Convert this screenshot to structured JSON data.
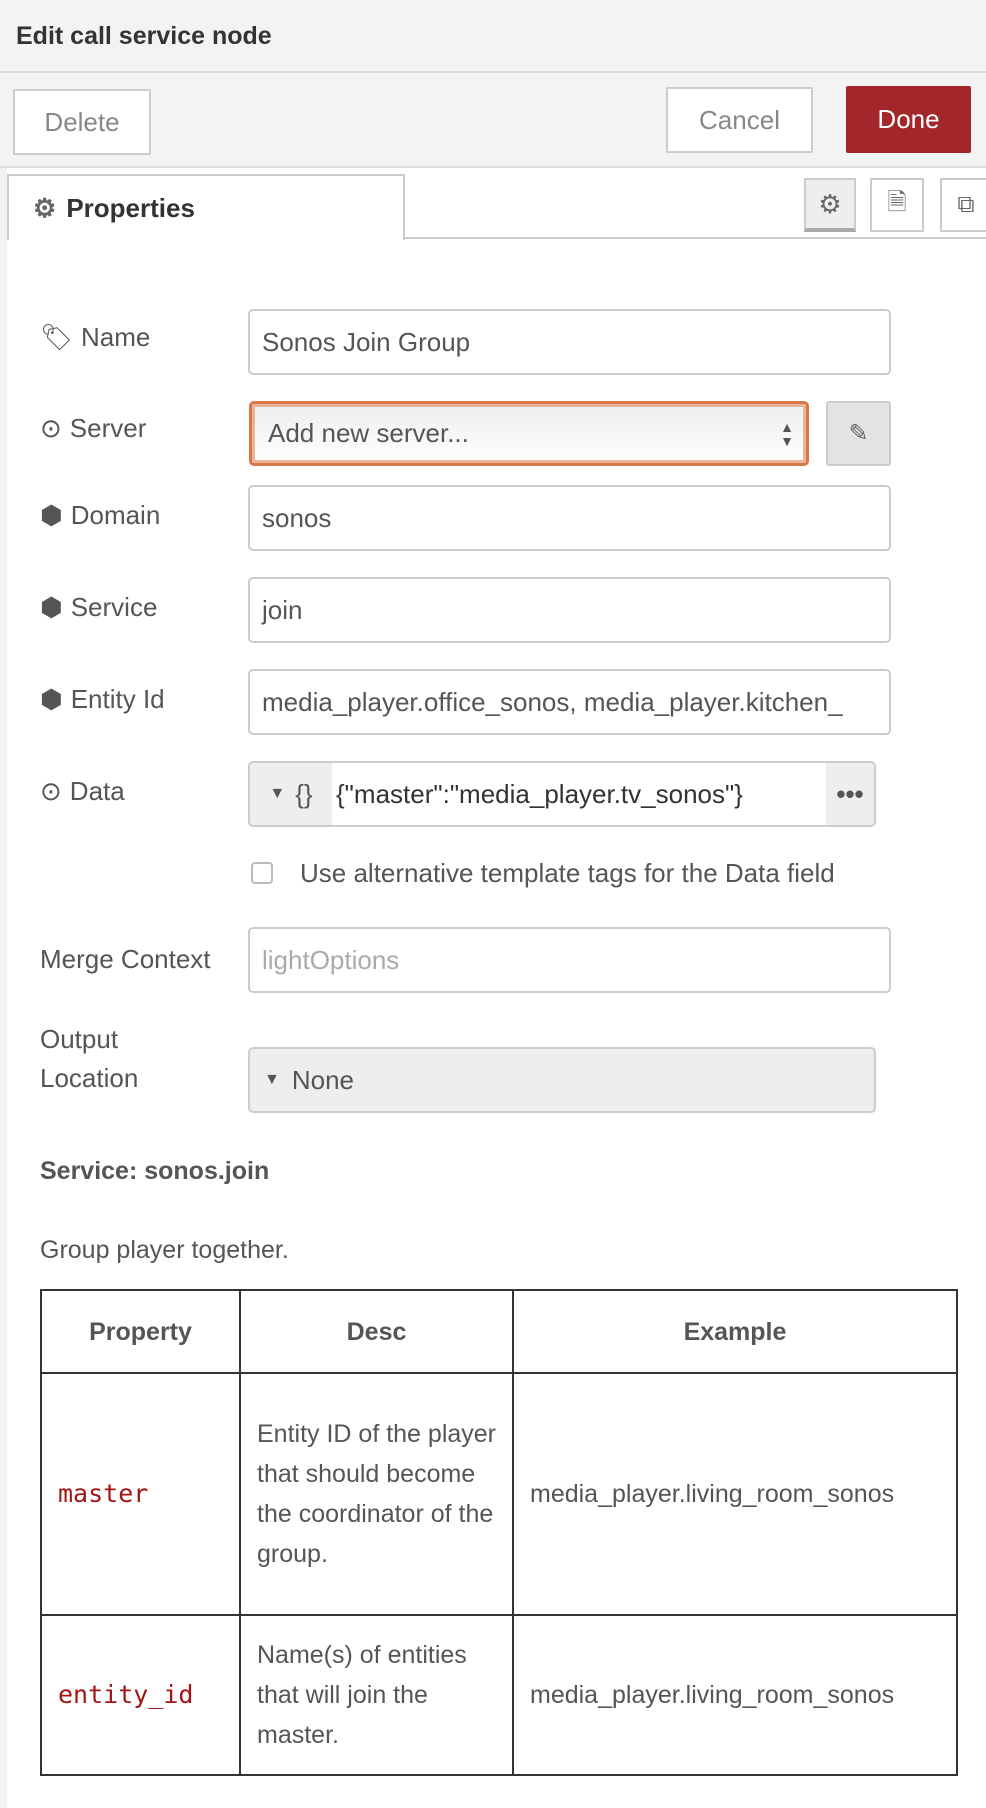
{
  "header": {
    "title": "Edit call service node"
  },
  "toolbar": {
    "delete": "Delete",
    "cancel": "Cancel",
    "done": "Done"
  },
  "tabs": {
    "properties": "Properties"
  },
  "colors": {
    "done": "#a2262a",
    "focus": "#d9774a",
    "code": "#a31515"
  },
  "form": {
    "name": {
      "label": "Name",
      "value": "Sonos Join Group"
    },
    "server": {
      "label": "Server",
      "value": "Add new server..."
    },
    "domain": {
      "label": "Domain",
      "value": "sonos"
    },
    "service": {
      "label": "Service",
      "value": "join"
    },
    "entity": {
      "label": "Entity Id",
      "value": "media_player.office_sonos, media_player.kitchen_"
    },
    "data": {
      "label": "Data",
      "type": "{}",
      "value": "{\"master\":\"media_player.tv_sonos\"}"
    },
    "alt_tags": {
      "label": "Use alternative template tags for the Data field",
      "checked": false
    },
    "merge": {
      "label": "Merge Context",
      "placeholder": "lightOptions"
    },
    "output": {
      "label1": "Output",
      "label2": "Location",
      "value": "None"
    }
  },
  "service_info": {
    "heading": "Service: sonos.join",
    "description": "Group player together.",
    "columns": [
      "Property",
      "Desc",
      "Example"
    ],
    "rows": [
      {
        "property": "master",
        "desc": "Entity ID of the player that should become the coordinator of the group.",
        "example": "media_player.living_room_sonos"
      },
      {
        "property": "entity_id",
        "desc": "Name(s) of entities that will join the master.",
        "example": "media_player.living_room_sonos"
      }
    ]
  }
}
